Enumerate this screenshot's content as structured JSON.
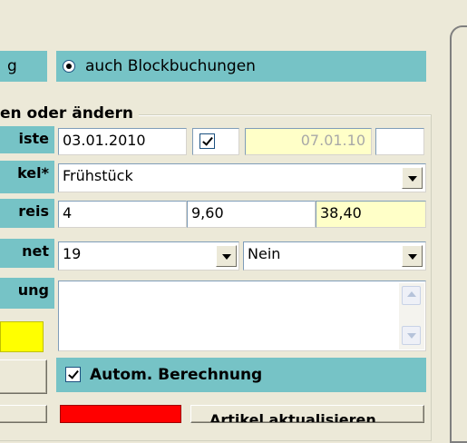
{
  "header": {
    "left_text": "g",
    "radio_label": "auch Blockbuchungen"
  },
  "group": {
    "title": "en oder ändern"
  },
  "rows": {
    "r1_label": "iste",
    "r2_label": "kel*",
    "r3_label": "reis",
    "r4_label": "net",
    "r5_label": "ung"
  },
  "fields": {
    "date_start": "03.01.2010",
    "date_end": "07.01.10",
    "article": "Frühstück",
    "quantity": "4",
    "unit_price": "9,60",
    "total_price": "38,40",
    "tax": "19",
    "calculated": "Nein",
    "notes": ""
  },
  "checkbox": {
    "autom_label": "Autom. Berechnung"
  },
  "bottom_button": {
    "label": "Artikel aktualisieren"
  },
  "colors": {
    "teal": "#76c3c6",
    "highlight_yellow": "#ffffc8",
    "bright_yellow": "#ffff00",
    "red": "#ff0000"
  }
}
